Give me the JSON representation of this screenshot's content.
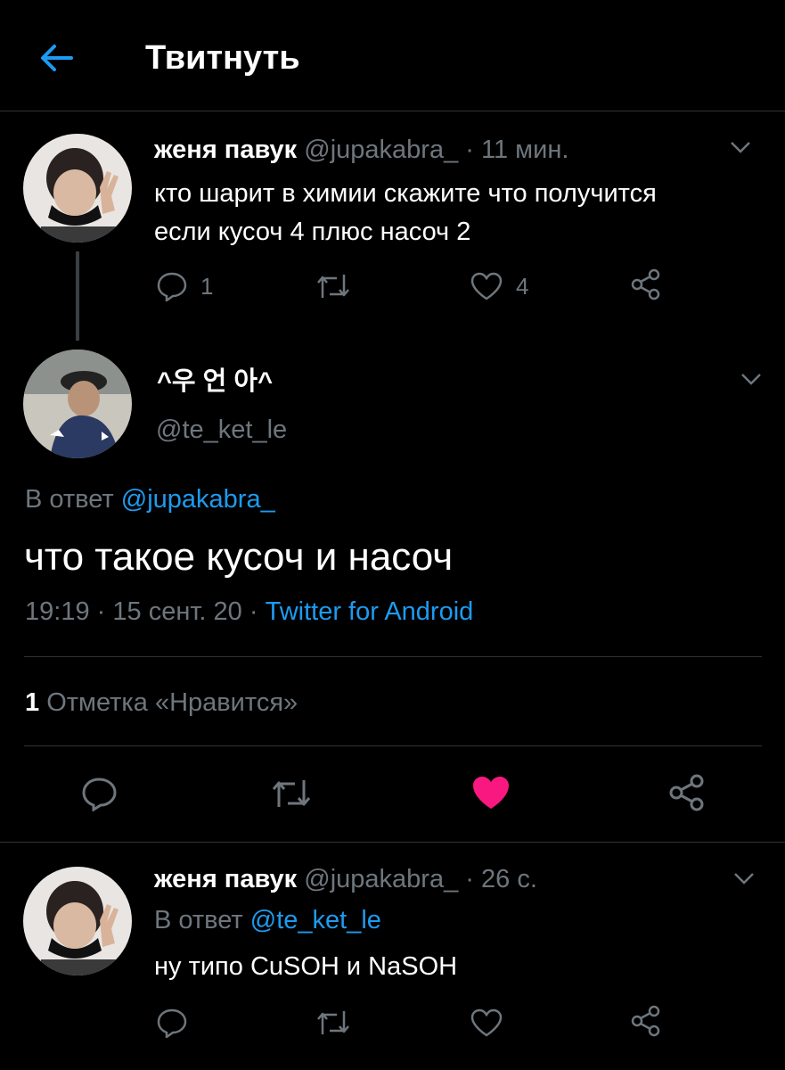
{
  "header": {
    "title": "Твитнуть"
  },
  "tweet1": {
    "name": "женя павук",
    "handle": "@jupakabra_",
    "sep": "·",
    "time": "11 мин.",
    "line1": "кто шарит в химии скажите что получится",
    "line2": "если кусоч 4 плюс насоч 2",
    "replies": "1",
    "likes": "4"
  },
  "main": {
    "name": "^우 언 아^",
    "handle": "@te_ket_le",
    "reply_prefix": "В ответ",
    "reply_to": "@jupakabra_",
    "text": "что такое кусоч и насоч",
    "time": "19:19",
    "sep1": "·",
    "date": "15 сент. 20",
    "sep2": "·",
    "source": "Twitter for Android",
    "likes_count": "1",
    "likes_label": "Отметка «Нравится»"
  },
  "tweet3": {
    "name": "женя павук",
    "handle": "@jupakabra_",
    "sep": "·",
    "time": "26 с.",
    "reply_prefix": "В ответ",
    "reply_to": "@te_ket_le",
    "text": "ну типо CuSOH и NaSOH"
  },
  "colors": {
    "accent": "#1d9bf0",
    "like": "#f91880",
    "muted": "#6e767d"
  }
}
